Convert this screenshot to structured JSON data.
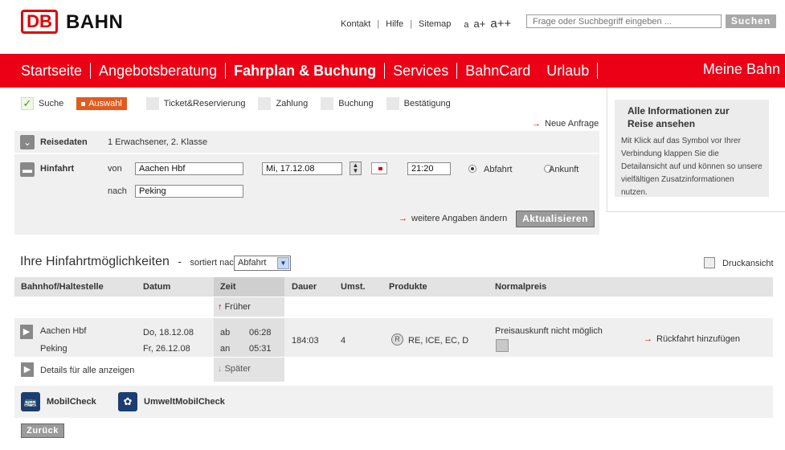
{
  "header": {
    "logo_mark": "DB",
    "logo_text": "BAHN",
    "links": [
      "Kontakt",
      "Hilfe",
      "Sitemap"
    ],
    "font_sizes": [
      "a",
      "a+",
      "a++"
    ],
    "search_placeholder": "Frage oder Suchbegriff eingeben ...",
    "search_button": "Suchen"
  },
  "nav": {
    "items": [
      "Startseite",
      "Angebotsberatung",
      "Fahrplan & Buchung",
      "Services",
      "BahnCard",
      "Urlaub"
    ],
    "meine_bahn": "Meine Bahn"
  },
  "steps": [
    "Suche",
    "Auswahl",
    "Ticket&Reservierung",
    "Zahlung",
    "Buchung",
    "Bestätigung"
  ],
  "neue_anfrage": "Neue Anfrage",
  "reisedaten": {
    "label": "Reisedaten",
    "value": "1 Erwachsener, 2. Klasse"
  },
  "hinfahrt": {
    "label": "Hinfahrt",
    "von_label": "von",
    "von_value": "Aachen Hbf",
    "nach_label": "nach",
    "nach_value": "Peking",
    "date": "Mi, 17.12.08",
    "time": "21:20",
    "abfahrt": "Abfahrt",
    "ankunft": "Ankunft",
    "weitere": "weitere Angaben ändern",
    "update_button": "Aktualisieren"
  },
  "info": {
    "title": "Alle Informationen zur Reise ansehen",
    "text": "Mit Klick auf das Symbol vor Ihrer Verbindung klappen Sie die Detailansicht auf und können so unsere vielfältigen Zusatzinformationen nutzen."
  },
  "results": {
    "title": "Ihre Hinfahrtmöglichkeiten",
    "dash": "-",
    "sort_label": "sortiert nach",
    "sort_value": "Abfahrt",
    "print": "Druckansicht",
    "columns": [
      "Bahnhof/Haltestelle",
      "Datum",
      "Zeit",
      "Dauer",
      "Umst.",
      "Produkte",
      "Normalpreis"
    ],
    "earlier": "Früher",
    "later": "Später",
    "row": {
      "from": "Aachen Hbf",
      "to": "Peking",
      "date_dep": "Do, 18.12.08",
      "date_arr": "Fr, 26.12.08",
      "ab": "ab",
      "an": "an",
      "time_dep": "06:28",
      "time_arr": "05:31",
      "duration": "184:03",
      "changes": "4",
      "products": "RE, ICE, EC, D",
      "price": "Preisauskunft nicht möglich",
      "return": "Rückfahrt hinzufügen"
    },
    "details_all": "Details für alle anzeigen"
  },
  "mobil": {
    "mobilcheck": "MobilCheck",
    "umwelt": "UmweltMobilCheck"
  },
  "back_button": "Zurück"
}
